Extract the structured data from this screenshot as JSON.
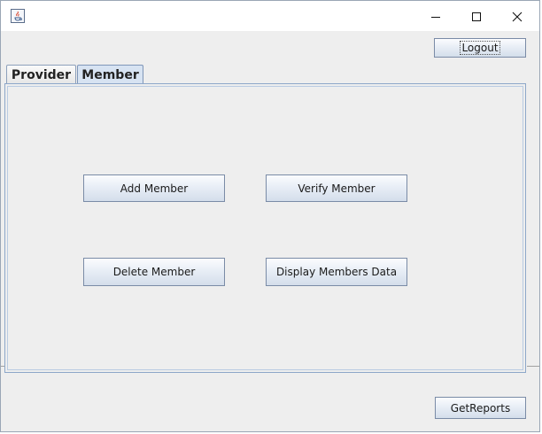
{
  "window": {
    "app_icon": "java-coffee-cup-icon",
    "controls": [
      "minimize-icon",
      "maximize-icon",
      "close-icon"
    ]
  },
  "toolbar": {
    "logout_label": "Logout"
  },
  "tabs": [
    {
      "label": "Provider",
      "selected": false
    },
    {
      "label": "Member",
      "selected": true
    }
  ],
  "member_panel": {
    "add_label": "Add Member",
    "verify_label": "Verify Member",
    "delete_label": "Delete Member",
    "display_label": "Display Members Data"
  },
  "footer": {
    "getreports_label": "GetReports"
  },
  "colors": {
    "selected_tab": "#d7e3f2",
    "button_border": "#7a8ba6",
    "panel_border": "#8da7c9"
  }
}
